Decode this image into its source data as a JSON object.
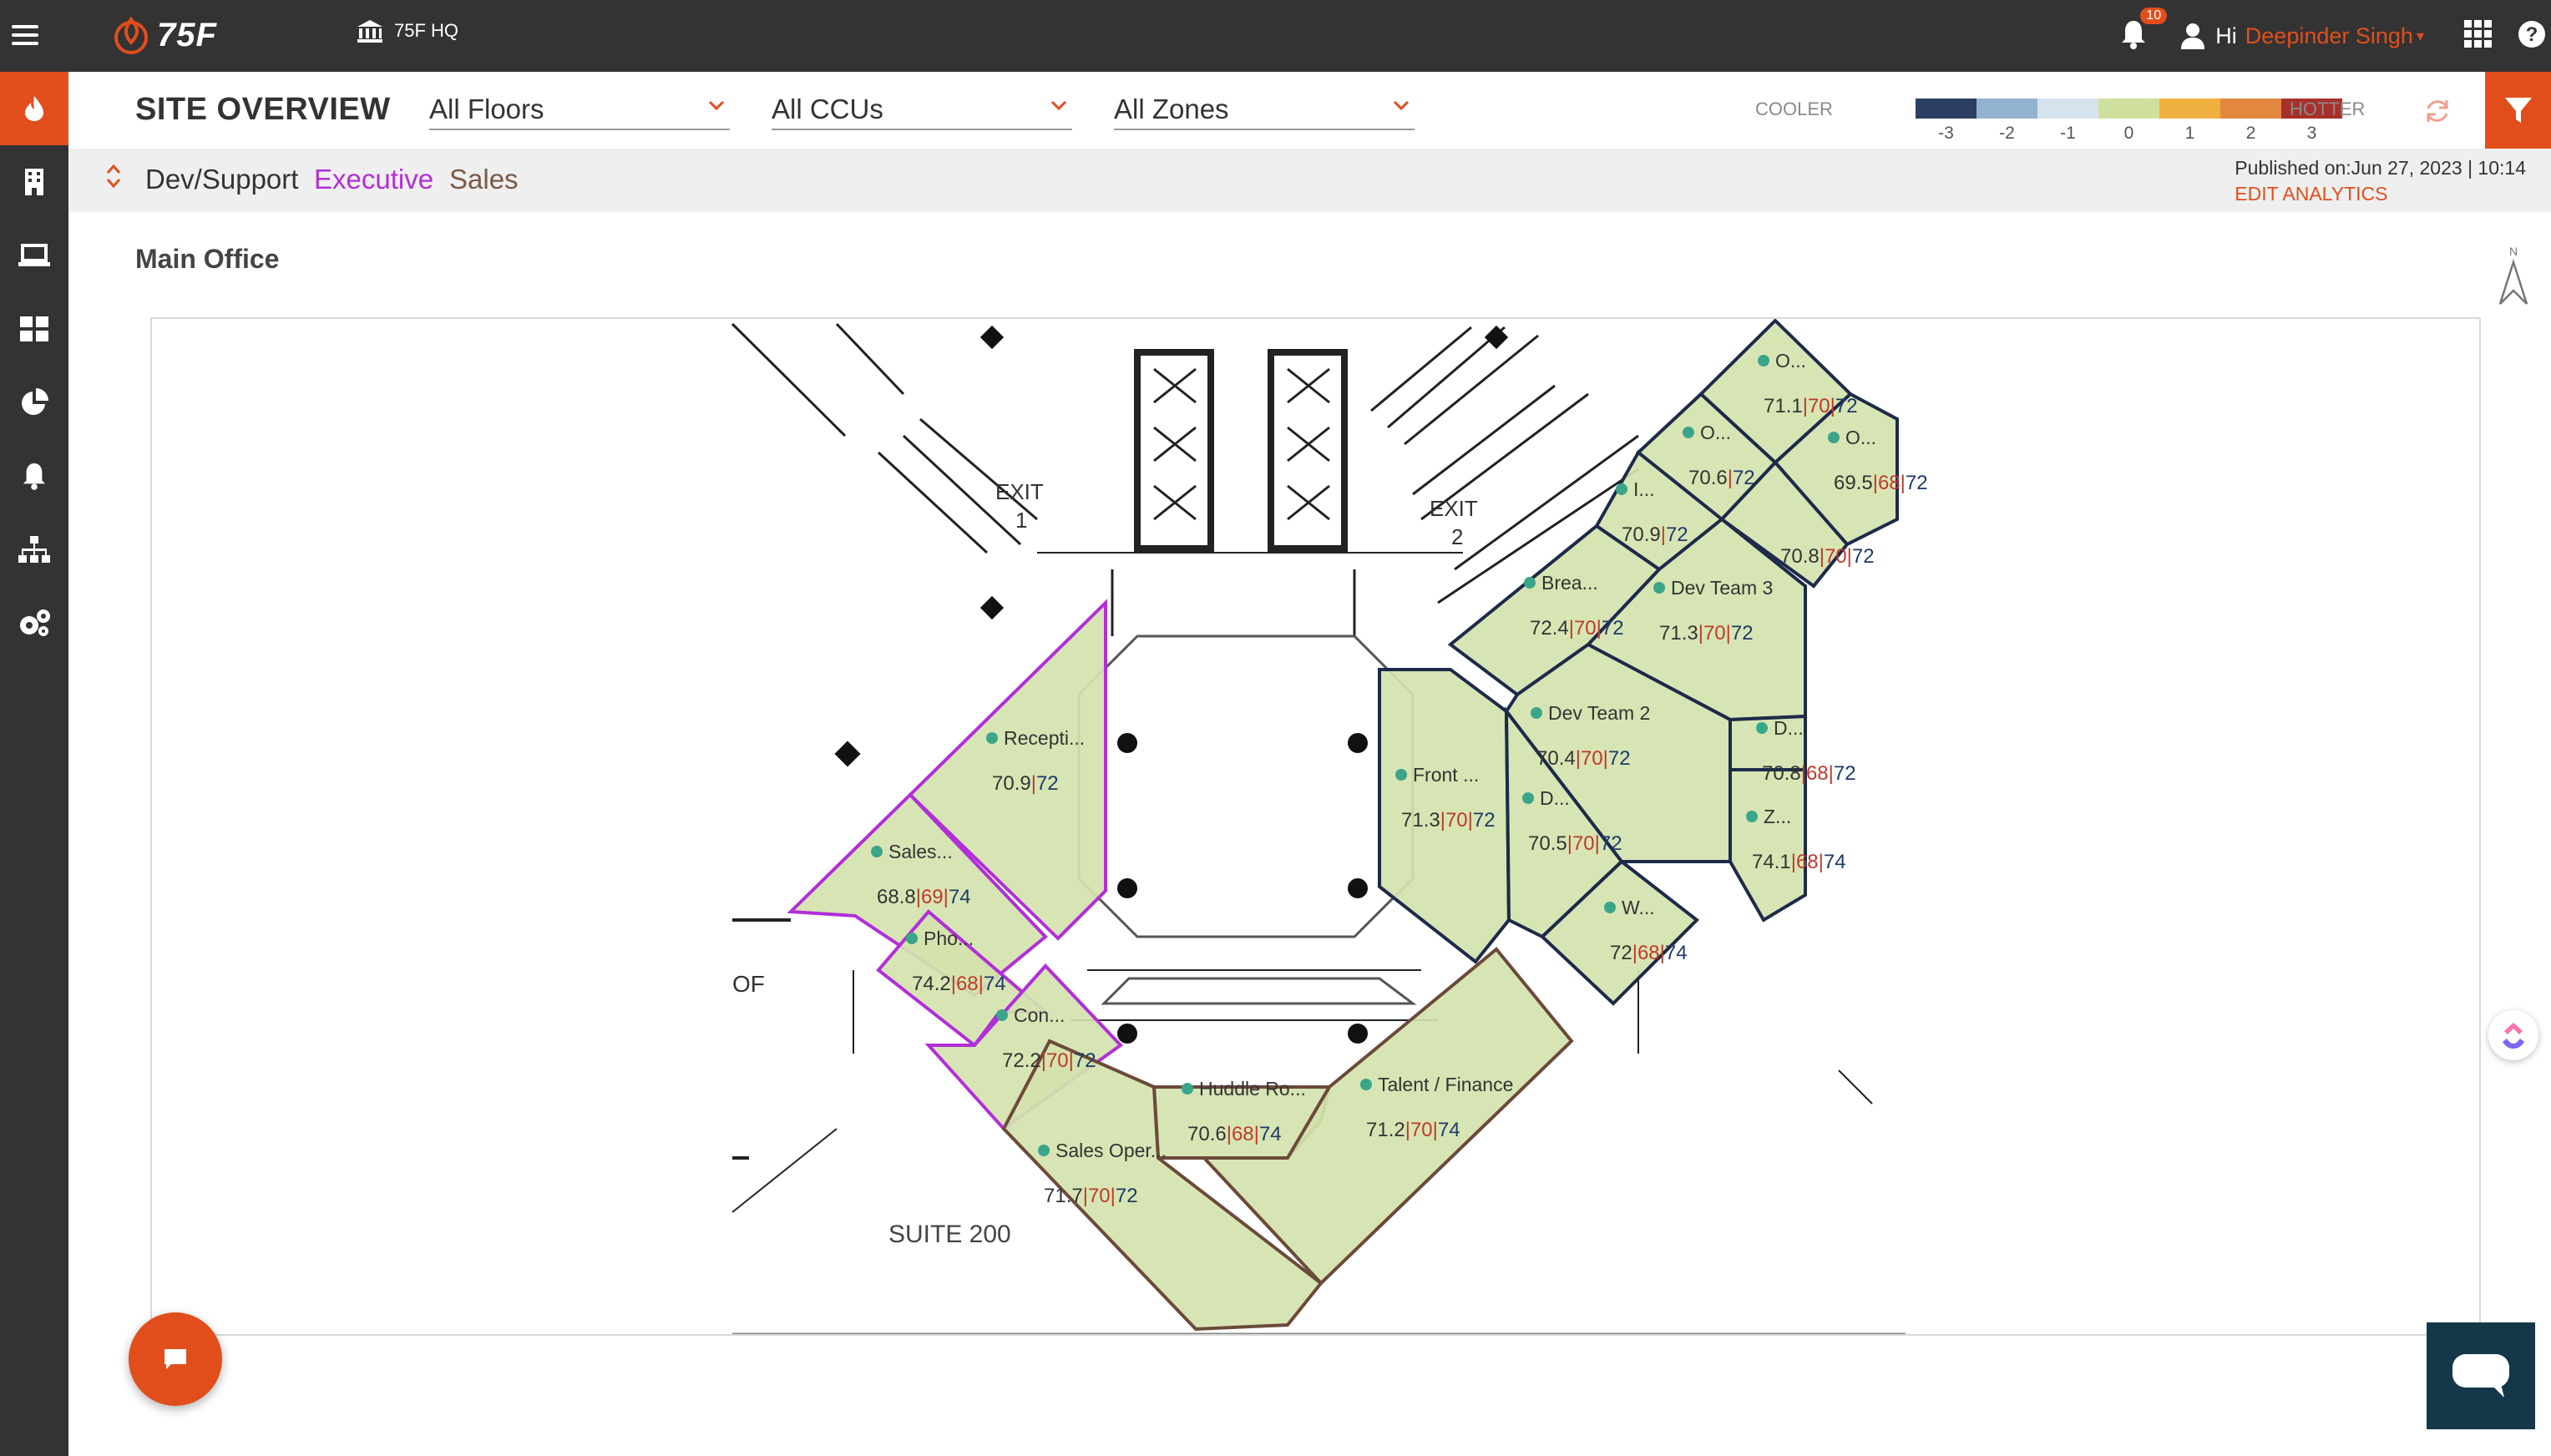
{
  "app": {
    "brand": "75F",
    "site": "75F HQ",
    "notification_count": "10",
    "greeting": "Hi",
    "user_name": "Deepinder Singh"
  },
  "header": {
    "title": "SITE OVERVIEW",
    "floors": "All Floors",
    "ccus": "All CCUs",
    "zones": "All Zones",
    "cooler": "COOLER",
    "hotter": "HOTTER",
    "legend": [
      {
        "value": "-3",
        "color": "#2c3e63"
      },
      {
        "value": "-2",
        "color": "#92b2cf"
      },
      {
        "value": "-1",
        "color": "#d6e3ef"
      },
      {
        "value": "0",
        "color": "#cfe09e"
      },
      {
        "value": "1",
        "color": "#f0b03f"
      },
      {
        "value": "2",
        "color": "#e2873f"
      },
      {
        "value": "3",
        "color": "#a8302a"
      }
    ]
  },
  "tabs": {
    "dev": "Dev/Support",
    "exec": "Executive",
    "sales": "Sales"
  },
  "published": {
    "text": "Published on:Jun 27, 2023 | 10:14",
    "edit": "EDIT ANALYTICS"
  },
  "floor": {
    "name": "Main Office",
    "north": "N",
    "suite": "SUITE 200",
    "exit1": "EXIT",
    "exit1n": "1",
    "exit2": "EXIT",
    "exit2n": "2",
    "of": "OF"
  },
  "zones": [
    {
      "id": "z1",
      "name": "O...",
      "cur": "71.1",
      "heat": "70",
      "cool": "72"
    },
    {
      "id": "z2",
      "name": "O...",
      "cur": "70.6",
      "heat": "",
      "cool": "72"
    },
    {
      "id": "z3",
      "name": "O...",
      "cur": "69.5",
      "heat": "68",
      "cool": "72"
    },
    {
      "id": "z4",
      "name": "I...",
      "cur": "70.9",
      "heat": "",
      "cool": "72"
    },
    {
      "id": "z5",
      "name": "",
      "cur": "70.8",
      "heat": "70",
      "cool": "72"
    },
    {
      "id": "z6",
      "name": "Brea...",
      "cur": "72.4",
      "heat": "70",
      "cool": "72"
    },
    {
      "id": "z7",
      "name": "Dev Team 3",
      "cur": "71.3",
      "heat": "70",
      "cool": "72"
    },
    {
      "id": "z8",
      "name": "Dev Team 2",
      "cur": "70.4",
      "heat": "70",
      "cool": "72"
    },
    {
      "id": "z9",
      "name": "D...",
      "cur": "70.8",
      "heat": "68",
      "cool": "72"
    },
    {
      "id": "z10",
      "name": "Front ...",
      "cur": "71.3",
      "heat": "70",
      "cool": "72"
    },
    {
      "id": "z11",
      "name": "D...",
      "cur": "70.5",
      "heat": "70",
      "cool": "72"
    },
    {
      "id": "z12",
      "name": "Z...",
      "cur": "74.1",
      "heat": "68",
      "cool": "74"
    },
    {
      "id": "z13",
      "name": "W...",
      "cur": "72",
      "heat": "68",
      "cool": "74"
    },
    {
      "id": "z14",
      "name": "Recepti...",
      "cur": "70.9",
      "heat": "",
      "cool": "72"
    },
    {
      "id": "z15",
      "name": "Sales...",
      "cur": "68.8",
      "heat": "69",
      "cool": "74"
    },
    {
      "id": "z16",
      "name": "Pho...",
      "cur": "74.2",
      "heat": "68",
      "cool": "74"
    },
    {
      "id": "z17",
      "name": "Con...",
      "cur": "72.2",
      "heat": "70",
      "cool": "72"
    },
    {
      "id": "z18",
      "name": "Huddle Ro...",
      "cur": "70.6",
      "heat": "68",
      "cool": "74"
    },
    {
      "id": "z19",
      "name": "Talent / Finance",
      "cur": "71.2",
      "heat": "70",
      "cool": "74"
    },
    {
      "id": "z20",
      "name": "Sales Oper...",
      "cur": "71.7",
      "heat": "70",
      "cool": "72"
    }
  ]
}
